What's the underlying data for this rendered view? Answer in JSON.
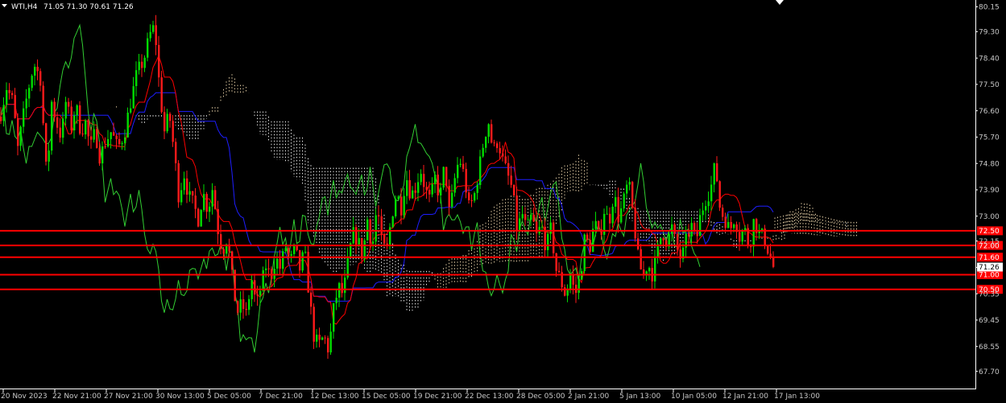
{
  "header": {
    "symbol": "WTI,H4",
    "ohlc": "71.05 71.30 70.61 71.26"
  },
  "colors": {
    "background": "#000000",
    "bull": "#00dc00",
    "bear": "#ff1a1a",
    "tenkan": "#ff0000",
    "kijun": "#1e1eff",
    "chikou": "#32cd32",
    "cloud_a": "#f5deb3",
    "cloud_b": "#ffffff",
    "level": "#ff0000",
    "axis": "#ffffff"
  },
  "chart_data": {
    "type": "candlestick",
    "title": "",
    "xlabel": "",
    "ylabel": "",
    "ylim": [
      67.36,
      80.3
    ],
    "y_ticks": [
      80.15,
      79.3,
      78.4,
      77.5,
      76.6,
      75.7,
      74.8,
      73.9,
      73.0,
      72.15,
      71.25,
      70.35,
      69.45,
      68.55,
      67.7
    ],
    "x_ticks": [
      "20 Nov 2023",
      "22 Nov 21:00",
      "27 Nov 21:00",
      "30 Nov 13:00",
      "5 Dec 05:00",
      "7 Dec 21:00",
      "12 Dec 13:00",
      "15 Dec 05:00",
      "19 Dec 21:00",
      "22 Dec 13:00",
      "28 Dec 05:00",
      "2 Jan 21:00",
      "5 Jan 13:00",
      "10 Jan 05:00",
      "12 Jan 21:00",
      "17 Jan 13:00"
    ],
    "current_price": "71.26",
    "horizontal_levels": [
      {
        "label": "72.50",
        "value": 72.5
      },
      {
        "label": "72.00",
        "value": 72.0
      },
      {
        "label": "71.60",
        "value": 71.6
      },
      {
        "label": "71.00",
        "value": 71.0
      },
      {
        "label": "70.50",
        "value": 70.5
      }
    ],
    "price_path": [
      [
        0,
        76.4
      ],
      [
        8,
        77.4
      ],
      [
        16,
        76.9
      ],
      [
        22,
        75.3
      ],
      [
        28,
        76.3
      ],
      [
        34,
        77.2
      ],
      [
        42,
        78.2
      ],
      [
        50,
        77.7
      ],
      [
        58,
        74.2
      ],
      [
        64,
        76.9
      ],
      [
        70,
        76.2
      ],
      [
        76,
        75.7
      ],
      [
        82,
        77.0
      ],
      [
        88,
        76.0
      ],
      [
        94,
        76.8
      ],
      [
        100,
        75.9
      ],
      [
        106,
        76.2
      ],
      [
        112,
        75.3
      ],
      [
        118,
        75.9
      ],
      [
        124,
        75.0
      ],
      [
        130,
        75.5
      ],
      [
        138,
        75.9
      ],
      [
        146,
        75.3
      ],
      [
        154,
        75.8
      ],
      [
        162,
        76.9
      ],
      [
        170,
        77.9
      ],
      [
        178,
        78.3
      ],
      [
        186,
        79.2
      ],
      [
        192,
        79.5
      ],
      [
        198,
        77.3
      ],
      [
        204,
        75.9
      ],
      [
        210,
        76.5
      ],
      [
        216,
        75.2
      ],
      [
        222,
        73.6
      ],
      [
        228,
        74.5
      ],
      [
        234,
        73.7
      ],
      [
        240,
        73.4
      ],
      [
        246,
        72.9
      ],
      [
        252,
        73.8
      ],
      [
        258,
        73.2
      ],
      [
        264,
        74.0
      ],
      [
        270,
        72.6
      ],
      [
        276,
        71.8
      ],
      [
        282,
        72.3
      ],
      [
        288,
        70.9
      ],
      [
        294,
        69.7
      ],
      [
        300,
        70.0
      ],
      [
        306,
        69.6
      ],
      [
        312,
        70.9
      ],
      [
        318,
        69.9
      ],
      [
        324,
        70.6
      ],
      [
        330,
        71.3
      ],
      [
        336,
        70.9
      ],
      [
        342,
        71.6
      ],
      [
        348,
        71.2
      ],
      [
        354,
        72.0
      ],
      [
        360,
        71.4
      ],
      [
        366,
        71.9
      ],
      [
        372,
        71.2
      ],
      [
        378,
        71.8
      ],
      [
        384,
        70.2
      ],
      [
        390,
        68.8
      ],
      [
        396,
        68.6
      ],
      [
        402,
        68.9
      ],
      [
        408,
        68.4
      ],
      [
        414,
        69.8
      ],
      [
        420,
        70.6
      ],
      [
        426,
        70.3
      ],
      [
        432,
        71.5
      ],
      [
        438,
        72.4
      ],
      [
        444,
        72.2
      ],
      [
        450,
        71.6
      ],
      [
        456,
        72.9
      ],
      [
        462,
        71.9
      ],
      [
        468,
        73.4
      ],
      [
        474,
        72.0
      ],
      [
        480,
        71.8
      ],
      [
        486,
        73.0
      ],
      [
        492,
        73.8
      ],
      [
        498,
        73.3
      ],
      [
        504,
        74.4
      ],
      [
        510,
        73.7
      ],
      [
        516,
        74.0
      ],
      [
        522,
        74.6
      ],
      [
        528,
        73.9
      ],
      [
        534,
        73.5
      ],
      [
        540,
        74.3
      ],
      [
        546,
        73.6
      ],
      [
        552,
        74.8
      ],
      [
        558,
        73.0
      ],
      [
        564,
        74.2
      ],
      [
        570,
        75.0
      ],
      [
        576,
        74.4
      ],
      [
        582,
        73.3
      ],
      [
        588,
        73.6
      ],
      [
        594,
        74.5
      ],
      [
        600,
        75.5
      ],
      [
        606,
        76.3
      ],
      [
        612,
        75.2
      ],
      [
        618,
        75.6
      ],
      [
        624,
        74.9
      ],
      [
        630,
        74.4
      ],
      [
        636,
        73.9
      ],
      [
        642,
        72.5
      ],
      [
        648,
        73.1
      ],
      [
        654,
        72.5
      ],
      [
        660,
        73.0
      ],
      [
        666,
        72.3
      ],
      [
        672,
        72.7
      ],
      [
        678,
        71.9
      ],
      [
        684,
        72.6
      ],
      [
        690,
        71.2
      ],
      [
        696,
        70.8
      ],
      [
        702,
        70.3
      ],
      [
        708,
        71.0
      ],
      [
        714,
        70.3
      ],
      [
        720,
        70.9
      ],
      [
        726,
        72.3
      ],
      [
        732,
        71.9
      ],
      [
        738,
        72.8
      ],
      [
        744,
        72.2
      ],
      [
        750,
        73.2
      ],
      [
        756,
        72.8
      ],
      [
        762,
        73.8
      ],
      [
        768,
        72.9
      ],
      [
        774,
        73.5
      ],
      [
        780,
        74.2
      ],
      [
        786,
        73.0
      ],
      [
        792,
        71.6
      ],
      [
        798,
        70.9
      ],
      [
        804,
        71.4
      ],
      [
        810,
        71.0
      ],
      [
        816,
        71.8
      ],
      [
        822,
        72.5
      ],
      [
        828,
        72.1
      ],
      [
        834,
        72.6
      ],
      [
        840,
        71.9
      ],
      [
        846,
        71.5
      ],
      [
        852,
        72.2
      ],
      [
        858,
        72.7
      ],
      [
        864,
        72.1
      ],
      [
        870,
        73.1
      ],
      [
        876,
        73.6
      ],
      [
        882,
        73.9
      ],
      [
        888,
        74.8
      ],
      [
        894,
        73.2
      ],
      [
        900,
        72.9
      ],
      [
        906,
        72.5
      ],
      [
        912,
        73.0
      ],
      [
        918,
        72.3
      ],
      [
        924,
        72.6
      ],
      [
        930,
        71.9
      ],
      [
        936,
        72.9
      ],
      [
        942,
        72.4
      ],
      [
        948,
        72.3
      ],
      [
        954,
        71.8
      ],
      [
        960,
        71.26
      ]
    ]
  }
}
